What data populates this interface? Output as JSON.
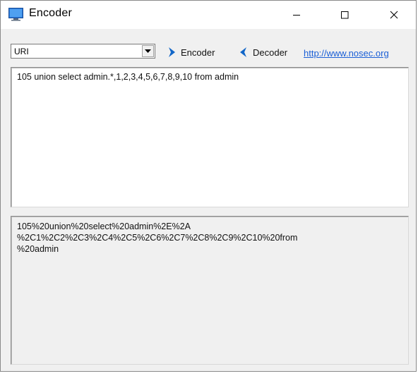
{
  "window": {
    "title": "Encoder"
  },
  "toolbar": {
    "mode_value": "URI",
    "encoder_label": "Encoder",
    "decoder_label": "Decoder",
    "link_text": "http://www.nosec.org"
  },
  "input": {
    "text": "105 union select admin.*,1,2,3,4,5,6,7,8,9,10 from admin"
  },
  "output": {
    "lines": [
      "105%20union%20select%20admin%2E%2A",
      "%2C1%2C2%2C3%2C4%2C5%2C6%2C7%2C8%2C9%2C10%20from",
      "%20admin"
    ]
  },
  "colors": {
    "link": "#1a5fd6",
    "arrow": "#1166c8"
  }
}
